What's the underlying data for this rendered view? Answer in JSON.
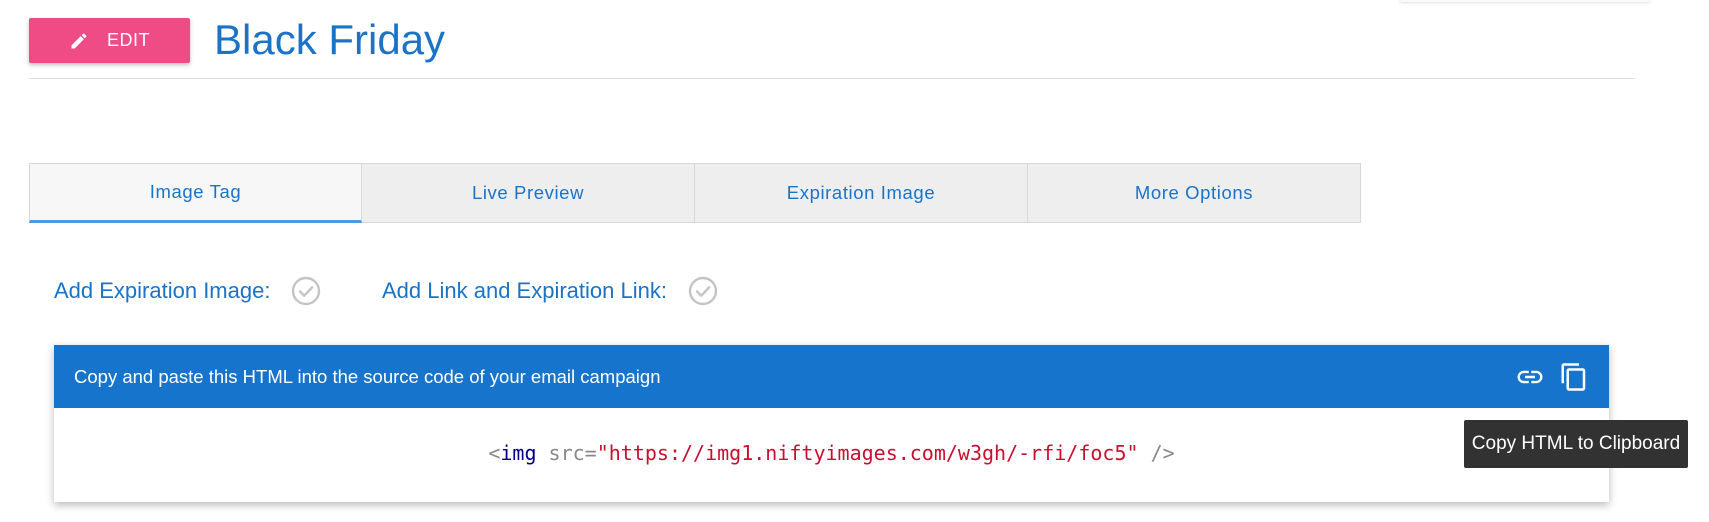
{
  "header": {
    "edit_label": "EDIT",
    "title": "Black Friday"
  },
  "tabs": [
    {
      "label": "Image Tag",
      "active": true
    },
    {
      "label": "Live Preview",
      "active": false
    },
    {
      "label": "Expiration Image",
      "active": false
    },
    {
      "label": "More Options",
      "active": false
    }
  ],
  "options": {
    "expiration_image_label": "Add Expiration Image:",
    "expiration_image_checked": false,
    "link_label": "Add Link and Expiration Link:",
    "link_checked": false
  },
  "code_panel": {
    "instruction": "Copy and paste this HTML into the source code of your email campaign",
    "code": {
      "open": "<",
      "tag": "img",
      "attr": " src=",
      "value": "\"https://img1.niftyimages.com/w3gh/-rfi/foc5\"",
      "close": " />"
    }
  },
  "tooltip": {
    "text": "Copy HTML to Clipboard"
  },
  "colors": {
    "accent_blue": "#1b73c7",
    "panel_header": "#1774cc",
    "edit_button": "#ef4b84"
  },
  "icons": [
    "pencil-icon",
    "check-circle-icon",
    "link-icon",
    "copy-icon"
  ]
}
